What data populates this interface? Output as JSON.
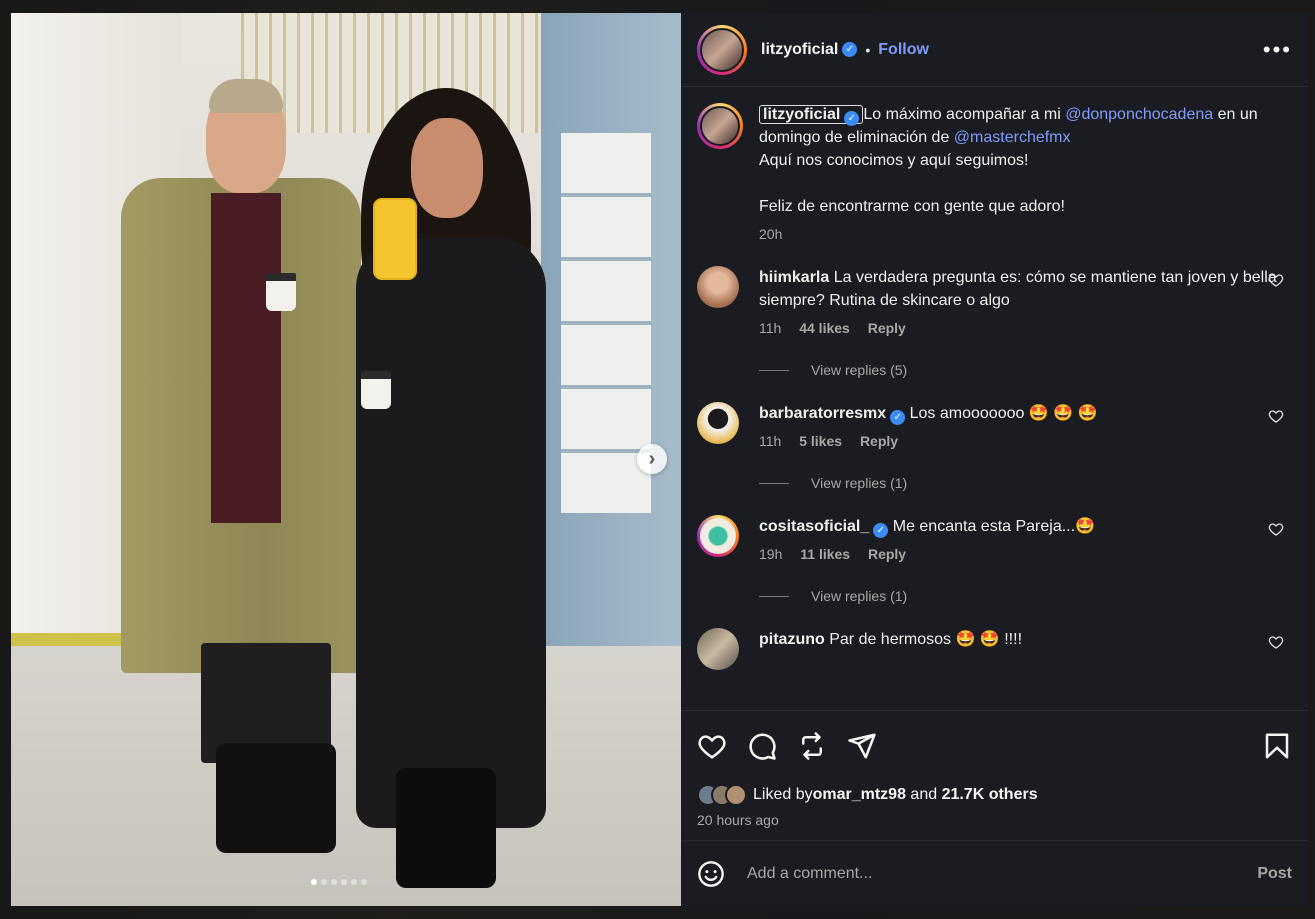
{
  "post": {
    "author": "litzyoficial",
    "follow_label": "Follow",
    "separator": "•",
    "more_label": "•••",
    "image_dots": 6,
    "active_dot": 0,
    "next_label": "›"
  },
  "caption": {
    "author": "litzyoficial",
    "text_1": "Lo máximo acompañar a mi ",
    "mention_1": "@donponchocadena",
    "text_2": " en un domingo de eliminación de ",
    "mention_2": "@masterchefmx",
    "line_3": "Aquí nos conocimos y aquí seguimos!",
    "line_4": "Feliz de encontrarme con gente que adoro!",
    "time": "20h"
  },
  "comments": [
    {
      "user": "hiimkarla",
      "verified": false,
      "text": "La verdadera pregunta es: cómo se mantiene tan joven y bella siempre? Rutina de skincare o algo",
      "time": "11h",
      "likes": "44 likes",
      "reply": "Reply",
      "view_replies": "View replies (5)"
    },
    {
      "user": "barbaratorresmx",
      "verified": true,
      "text": "Los amooooooo 🤩 🤩 🤩",
      "time": "11h",
      "likes": "5 likes",
      "reply": "Reply",
      "view_replies": "View replies (1)"
    },
    {
      "user": "cositasoficial_",
      "verified": true,
      "text": "Me encanta esta Pareja...🤩",
      "time": "19h",
      "likes": "11 likes",
      "reply": "Reply",
      "view_replies": "View replies (1)"
    },
    {
      "user": "pitazuno",
      "verified": false,
      "text": "Par de hermosos 🤩 🤩 !!!!"
    }
  ],
  "engagement": {
    "liked_prefix": "Liked by ",
    "liked_user": "omar_mtz98",
    "liked_mid": " and ",
    "liked_others": "21.7K others",
    "posted_time": "20 hours ago"
  },
  "add_comment": {
    "placeholder": "Add a comment...",
    "post_label": "Post"
  },
  "colors": {
    "background": "#1b1c21",
    "link": "#7e9bf9",
    "verified": "#3b8cf5",
    "muted": "#a8a8a8"
  },
  "icons": [
    "heart-icon",
    "comment-icon",
    "share-icon",
    "send-icon",
    "bookmark-icon",
    "emoji-icon",
    "more-icon",
    "chevron-right-icon",
    "verified-icon"
  ]
}
